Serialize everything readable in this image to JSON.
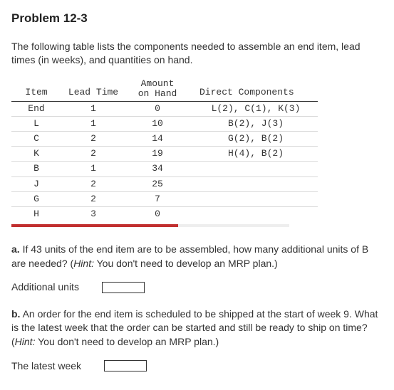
{
  "title": "Problem 12-3",
  "intro": "The following table lists the components needed to assemble an end item, lead times (in weeks), and quantities on hand.",
  "table": {
    "headers": {
      "item": "Item",
      "lead": "Lead Time",
      "amount_l1": "Amount",
      "amount_l2": "on Hand",
      "direct": "Direct Components"
    },
    "rows": [
      {
        "item": "End",
        "lead": "1",
        "amt": "0",
        "dc": "L(2), C(1), K(3)"
      },
      {
        "item": "L",
        "lead": "1",
        "amt": "10",
        "dc": "B(2), J(3)"
      },
      {
        "item": "C",
        "lead": "2",
        "amt": "14",
        "dc": "G(2), B(2)"
      },
      {
        "item": "K",
        "lead": "2",
        "amt": "19",
        "dc": "H(4), B(2)"
      },
      {
        "item": "B",
        "lead": "1",
        "amt": "34",
        "dc": ""
      },
      {
        "item": "J",
        "lead": "2",
        "amt": "25",
        "dc": ""
      },
      {
        "item": "G",
        "lead": "2",
        "amt": "7",
        "dc": ""
      },
      {
        "item": "H",
        "lead": "3",
        "amt": "0",
        "dc": ""
      }
    ]
  },
  "qa": {
    "a_label": "a.",
    "a_text": " If 43 units of the end item are to be assembled, how many additional units of B are needed? (",
    "a_hint_label": "Hint:",
    "a_hint_text": " You don't need to develop an MRP plan.)",
    "a_answer_label": "Additional units",
    "b_label": "b.",
    "b_text": " An order for the end item is scheduled to be shipped at the start of week 9. What is the latest week that the order can be started and still be ready to ship on time? (",
    "b_hint_label": "Hint:",
    "b_hint_text": " You don't need to develop an MRP plan.)",
    "b_answer_label": "The latest week"
  }
}
